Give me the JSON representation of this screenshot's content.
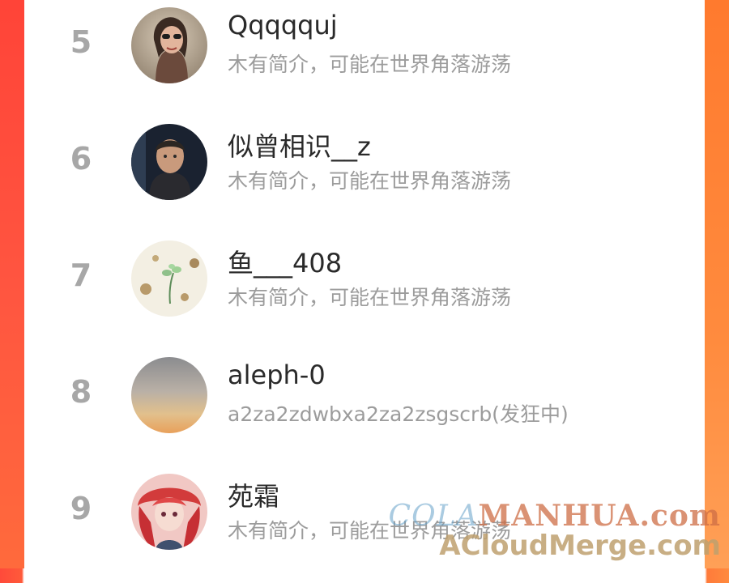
{
  "colors": {
    "frame_left": "#ff4a3a",
    "frame_right": "#ff8a3e",
    "rank_text": "#a7a7a7",
    "name_text": "#2a2a2a",
    "bio_text": "#9c9c9c"
  },
  "list": {
    "items": [
      {
        "rank": "5",
        "name": "Qqqqquj",
        "bio": "木有简介，可能在世界角落游荡",
        "avatar_icon": "avatar-woman-sunglasses"
      },
      {
        "rank": "6",
        "name": "似曾相识__z",
        "bio": "木有简介，可能在世界角落游荡",
        "avatar_icon": "avatar-portrait-dark"
      },
      {
        "rank": "7",
        "name": "鱼___408",
        "bio": "木有简介，可能在世界角落游荡",
        "avatar_icon": "avatar-plant-doodle"
      },
      {
        "rank": "8",
        "name": "aleph-0",
        "bio": "a2za2zdwbxa2za2zsgscrb(发狂中)",
        "avatar_icon": "avatar-sunset-gradient"
      },
      {
        "rank": "9",
        "name": "苑霜",
        "bio": "木有简介，可能在世界角落游荡",
        "avatar_icon": "avatar-anime-red-hair"
      }
    ]
  },
  "watermark": {
    "line1_cola": "COLA",
    "line1_manhua": "MANHUA",
    "line1_suffix": ".com",
    "line2": "ACloudMerge.com"
  }
}
